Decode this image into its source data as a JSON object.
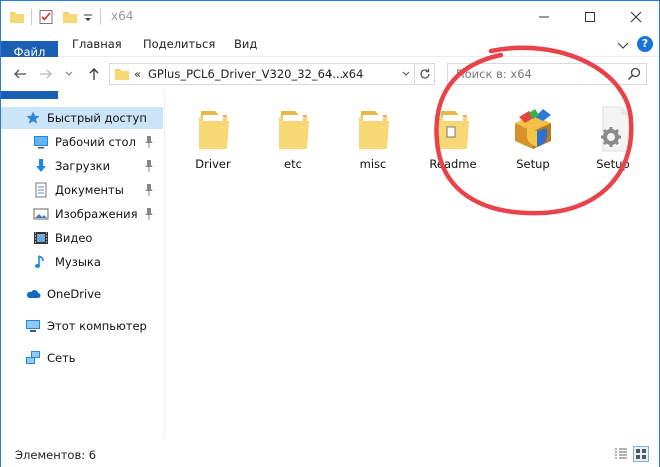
{
  "window": {
    "title": "x64",
    "accent": "#1a5fb4"
  },
  "ribbon": {
    "tabs": [
      {
        "label": "Файл"
      },
      {
        "label": "Главная"
      },
      {
        "label": "Поделиться"
      },
      {
        "label": "Вид"
      }
    ]
  },
  "navbar": {
    "address": {
      "overflow": "«",
      "folder": "GPlus_PCL6_Driver_V320_32_64...",
      "separator": "›",
      "current": "x64"
    },
    "search_placeholder": "Поиск в: x64"
  },
  "navpane": {
    "items": [
      {
        "label": "Быстрый доступ",
        "icon": "star-icon",
        "pinned": false
      },
      {
        "label": "Рабочий стол",
        "icon": "desktop-icon",
        "pinned": true
      },
      {
        "label": "Загрузки",
        "icon": "download-icon",
        "pinned": true
      },
      {
        "label": "Документы",
        "icon": "document-icon",
        "pinned": true
      },
      {
        "label": "Изображения",
        "icon": "pictures-icon",
        "pinned": true
      },
      {
        "label": "Видео",
        "icon": "video-icon",
        "pinned": false
      },
      {
        "label": "Музыка",
        "icon": "music-icon",
        "pinned": false
      },
      {
        "label": "OneDrive",
        "icon": "cloud-icon",
        "pinned": false
      },
      {
        "label": "Этот компьютер",
        "icon": "computer-icon",
        "pinned": false
      },
      {
        "label": "Сеть",
        "icon": "network-icon",
        "pinned": false
      }
    ]
  },
  "files": [
    {
      "name": "Driver",
      "icon": "folder-icon"
    },
    {
      "name": "etc",
      "icon": "folder-icon"
    },
    {
      "name": "misc",
      "icon": "folder-icon"
    },
    {
      "name": "Readme",
      "icon": "folder-doc-icon"
    },
    {
      "name": "Setup",
      "icon": "installer-icon"
    },
    {
      "name": "Setup",
      "icon": "settings-file-icon"
    }
  ],
  "statusbar": {
    "items_count": "Элементов: 6"
  }
}
